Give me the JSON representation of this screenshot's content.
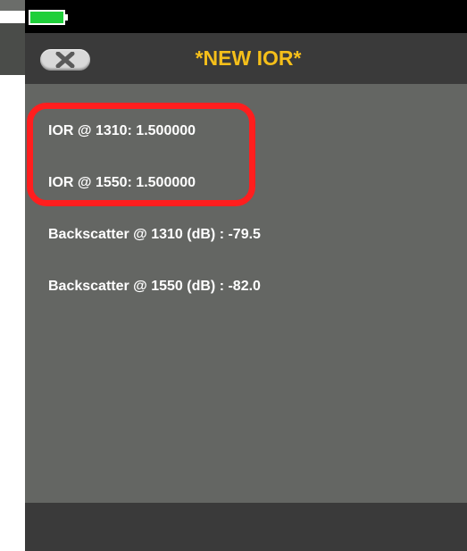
{
  "header": {
    "title": "*NEW IOR*",
    "back_icon": "close-x-icon"
  },
  "status_bar": {
    "battery_icon": "battery-icon",
    "battery_color": "#1fcf3a"
  },
  "settings": [
    {
      "label": "IOR @ 1310: 1.500000"
    },
    {
      "label": "IOR @ 1550: 1.500000"
    },
    {
      "label": "Backscatter @ 1310 (dB) : -79.5"
    },
    {
      "label": "Backscatter @ 1550 (dB) : -82.0"
    }
  ],
  "colors": {
    "title": "#f5bf1a",
    "highlight": "#ff1e1e",
    "content_bg": "#646663",
    "header_bg": "#3a3a3a"
  }
}
